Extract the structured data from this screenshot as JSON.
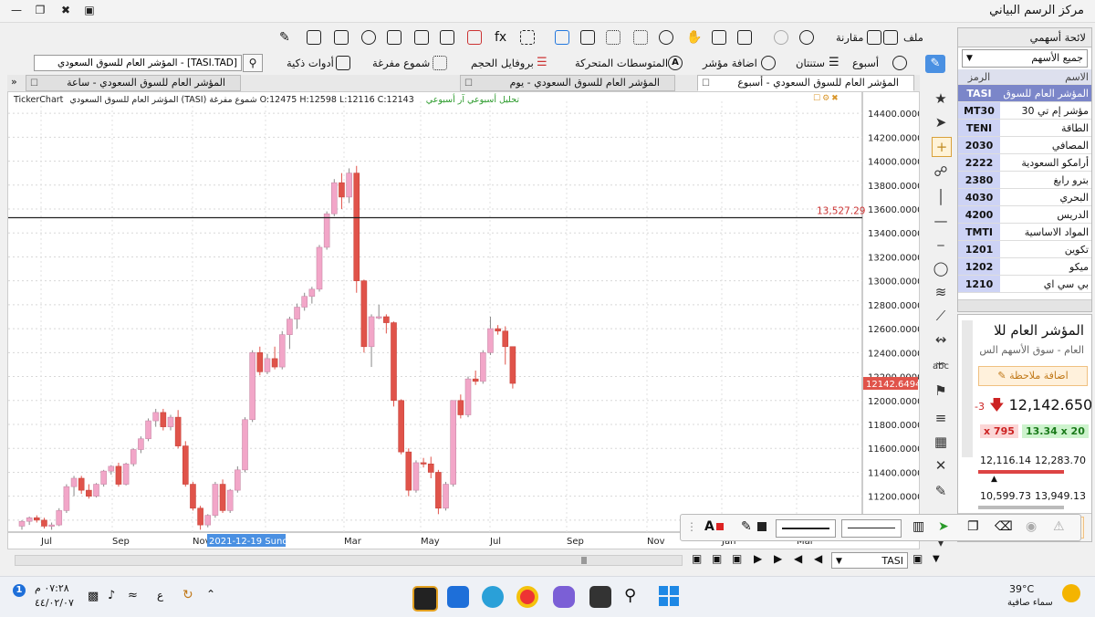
{
  "window": {
    "title": "مركز الرسم البياني"
  },
  "toolbar": {
    "file": "ملف",
    "compare": "مقارنة",
    "week": "أسبوع",
    "stantan": "ستنتان",
    "add_indicator": "اضافة مؤشر",
    "moving_averages": "المتوسطات المتحركة",
    "volume_profile": "بروفايل الحجم",
    "hollow_candles": "شموع مفرغة",
    "smart_tools": "أدوات ذكية",
    "search_value": "[TASI.TAD] - المؤشر العام للسوق السعودي"
  },
  "tabs": [
    {
      "label": "المؤشر العام للسوق السعودي - أسبوع",
      "active": true
    },
    {
      "label": "المؤشر العام للسوق السعودي - يوم",
      "active": false
    },
    {
      "label": "المؤشر العام للسوق السعودي - ساعة",
      "active": false
    }
  ],
  "chart_header": {
    "brand": "TickerChart",
    "info": "المؤشر العام للسوق السعودي (TASI) شموع مفرغة  O:12475  H:12598  L:12116  C:12143",
    "analysis_links": "تحليل أسبوعي   آر أسبوعي"
  },
  "watchlist": {
    "title": "لائحة أسهمي",
    "filter": "جميع الأسهم",
    "col_symbol": "الرمز",
    "col_name": "الاسم",
    "rows": [
      {
        "symbol": "TASI",
        "name": "المؤشر العام للسوق"
      },
      {
        "symbol": "MT30",
        "name": "مؤشر إم تي 30"
      },
      {
        "symbol": "TENI",
        "name": "الطاقة"
      },
      {
        "symbol": "2030",
        "name": "المصافي"
      },
      {
        "symbol": "2222",
        "name": "أرامكو السعودية"
      },
      {
        "symbol": "2380",
        "name": "بترو رابغ"
      },
      {
        "symbol": "4030",
        "name": "البحري"
      },
      {
        "symbol": "4200",
        "name": "الدريس"
      },
      {
        "symbol": "TMTI",
        "name": "المواد الاساسية"
      },
      {
        "symbol": "1201",
        "name": "تكوين"
      },
      {
        "symbol": "1202",
        "name": "ميكو"
      },
      {
        "symbol": "1210",
        "name": "بي سي اي"
      }
    ]
  },
  "symbol_panel": {
    "name": "المؤشر العام للا",
    "subtitle": "العام - سوق الأسهم الس",
    "add_note": "اضافة ملاحظة",
    "price": "12,142.650",
    "change_prefix": "-3",
    "bid": "x 795",
    "ask": "13.34 x 20",
    "low": "12,116.14",
    "high": "12,283.70",
    "low52": "10,599.73",
    "high52": "13,949.13"
  },
  "bottom": {
    "symbol": "TASI"
  },
  "taskbar": {
    "time": "٠٧:٢٨ م",
    "date": "٤٤/٠٢/٠٧",
    "temperature": "39°C",
    "weather": "سماء صافية",
    "lang": "ع"
  },
  "chart_data": {
    "type": "candlestick",
    "style": "hollow candles",
    "ylim": [
      10900,
      14500
    ],
    "y_ticks": [
      "11000.0000",
      "11200.0000",
      "11400.0000",
      "11600.0000",
      "11800.0000",
      "12000.0000",
      "12200.0000",
      "12400.0000",
      "12600.0000",
      "12800.0000",
      "13000.0000",
      "13200.0000",
      "13400.0000",
      "13600.0000",
      "13800.0000",
      "14000.0000",
      "14200.0000",
      "14400.0000"
    ],
    "x_labels": [
      "Jul",
      "Sep",
      "Nov",
      "Jan",
      "Mar",
      "May",
      "Jul",
      "Sep",
      "Nov",
      "Jan",
      "Mar"
    ],
    "crosshair_date": "2021-12-19 Sunday",
    "hline": {
      "value": 13527.29,
      "label": "13,527.29"
    },
    "last_price_label": "12142.6494",
    "candles": [
      [
        10950,
        11000,
        10920,
        10990
      ],
      [
        10990,
        11030,
        10960,
        11020
      ],
      [
        11020,
        11040,
        10980,
        11000
      ],
      [
        11000,
        11020,
        10930,
        10950
      ],
      [
        10950,
        10980,
        10920,
        10960
      ],
      [
        10960,
        11100,
        10950,
        11080
      ],
      [
        11080,
        11300,
        11060,
        11280
      ],
      [
        11280,
        11370,
        11200,
        11350
      ],
      [
        11350,
        11370,
        11220,
        11250
      ],
      [
        11250,
        11300,
        11180,
        11200
      ],
      [
        11200,
        11310,
        11190,
        11300
      ],
      [
        11300,
        11420,
        11280,
        11410
      ],
      [
        11410,
        11460,
        11380,
        11450
      ],
      [
        11450,
        11480,
        11280,
        11300
      ],
      [
        11300,
        11480,
        11290,
        11470
      ],
      [
        11470,
        11600,
        11450,
        11590
      ],
      [
        11590,
        11700,
        11560,
        11680
      ],
      [
        11680,
        11850,
        11660,
        11830
      ],
      [
        11830,
        11930,
        11780,
        11900
      ],
      [
        11900,
        11930,
        11750,
        11780
      ],
      [
        11780,
        11880,
        11750,
        11860
      ],
      [
        11860,
        11920,
        11600,
        11620
      ],
      [
        11620,
        11660,
        11280,
        11300
      ],
      [
        11300,
        11320,
        11080,
        11100
      ],
      [
        11100,
        11120,
        10920,
        10960
      ],
      [
        10960,
        11050,
        10940,
        11040
      ],
      [
        11040,
        11320,
        11020,
        11300
      ],
      [
        11300,
        11340,
        11060,
        11080
      ],
      [
        11080,
        11260,
        11060,
        11250
      ],
      [
        11250,
        11450,
        11230,
        11420
      ],
      [
        11420,
        11860,
        11400,
        11840
      ],
      [
        11840,
        12420,
        11820,
        12400
      ],
      [
        12400,
        12450,
        12210,
        12240
      ],
      [
        12240,
        12390,
        12220,
        12350
      ],
      [
        12350,
        12450,
        12260,
        12280
      ],
      [
        12280,
        12580,
        12260,
        12550
      ],
      [
        12550,
        12700,
        12430,
        12680
      ],
      [
        12680,
        12810,
        12600,
        12780
      ],
      [
        12780,
        12900,
        12750,
        12870
      ],
      [
        12870,
        12950,
        12810,
        12930
      ],
      [
        12930,
        13300,
        12910,
        13280
      ],
      [
        13280,
        13580,
        13260,
        13560
      ],
      [
        13560,
        13850,
        13540,
        13820
      ],
      [
        13820,
        13900,
        13600,
        13700
      ],
      [
        13700,
        13940,
        13650,
        13900
      ],
      [
        13900,
        13960,
        12900,
        13000
      ],
      [
        13000,
        13010,
        12400,
        12450
      ],
      [
        12450,
        12720,
        12280,
        12700
      ],
      [
        12700,
        12800,
        12680,
        12700
      ],
      [
        12700,
        12720,
        12560,
        12650
      ],
      [
        12650,
        12660,
        11950,
        12000
      ],
      [
        12000,
        12010,
        11550,
        11570
      ],
      [
        11570,
        11600,
        11200,
        11250
      ],
      [
        11250,
        11500,
        11230,
        11480
      ],
      [
        11480,
        11520,
        11440,
        11470
      ],
      [
        11470,
        11530,
        11350,
        11400
      ],
      [
        11400,
        11420,
        11050,
        11100
      ],
      [
        11100,
        11320,
        11080,
        11300
      ],
      [
        11300,
        12000,
        11280,
        12000
      ],
      [
        12000,
        12050,
        11850,
        11880
      ],
      [
        11880,
        12200,
        11860,
        12180
      ],
      [
        12180,
        12250,
        12130,
        12160
      ],
      [
        12160,
        12420,
        12140,
        12400
      ],
      [
        12400,
        12700,
        12380,
        12600
      ],
      [
        12600,
        12630,
        12550,
        12580
      ],
      [
        12580,
        12620,
        12300,
        12450
      ],
      [
        12450,
        12450,
        12100,
        12143
      ]
    ]
  }
}
